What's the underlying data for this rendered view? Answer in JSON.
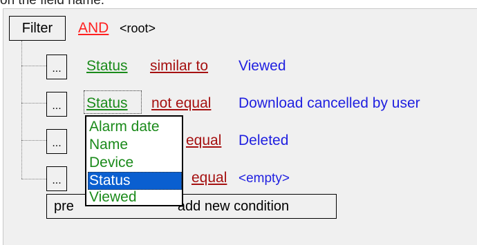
{
  "caption": "on the field name.",
  "filter": {
    "button_label": "Filter",
    "operator": "AND",
    "root_label": "<root>"
  },
  "conditions": [
    {
      "ellipsis": "...",
      "field": "Status",
      "op": "similar to",
      "value": "Viewed"
    },
    {
      "ellipsis": "...",
      "field": "Status",
      "op": "not equal",
      "value": "Download cancelled by user"
    },
    {
      "ellipsis": "...",
      "field": "",
      "op": "equal",
      "value": "Deleted"
    },
    {
      "ellipsis": "...",
      "field": "",
      "op": "equal",
      "value": "<empty>"
    }
  ],
  "add_condition": {
    "label_left": "pre",
    "label_right": "add new condition"
  },
  "field_dropdown": {
    "options": [
      "Alarm date",
      "Name",
      "Device",
      "Status",
      "Viewed"
    ],
    "selected": "Status"
  },
  "colors": {
    "field": "#1a8a1a",
    "operator": "#a51010",
    "value": "#2020e0",
    "logic": "#ff2020",
    "selection": "#0a5fd0"
  }
}
